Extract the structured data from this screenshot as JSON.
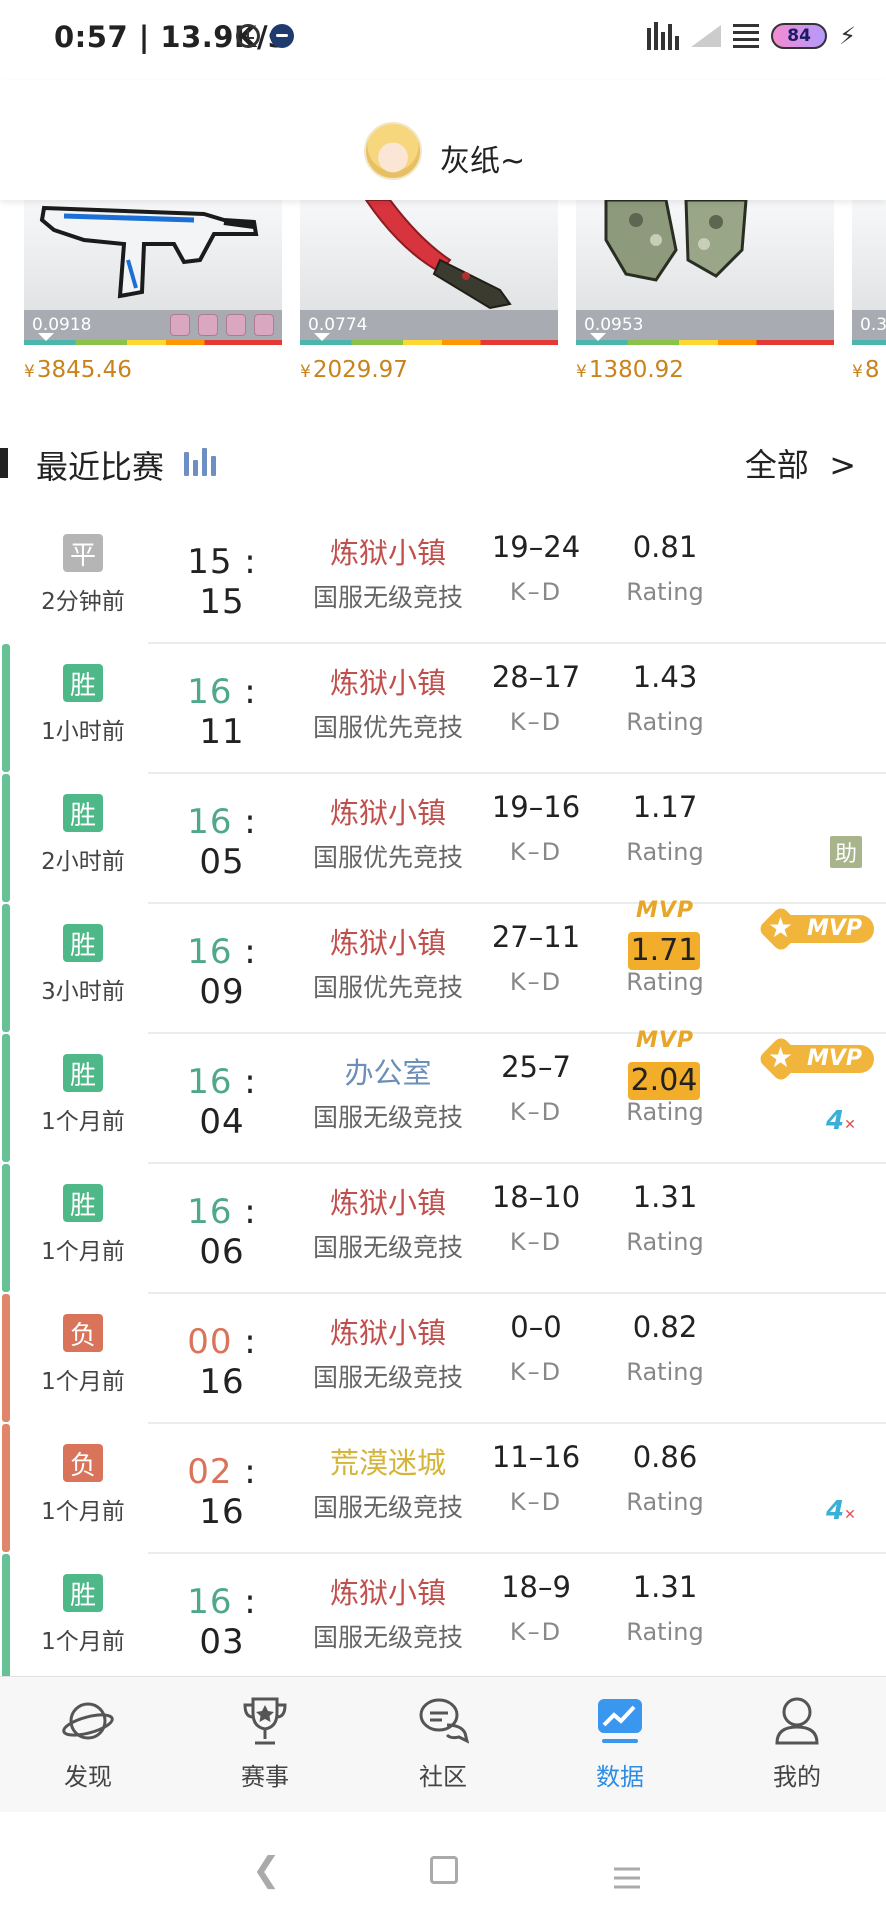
{
  "status_bar": {
    "time_speed": "0:57 | 13.9K/s",
    "battery": "84"
  },
  "header": {
    "username": "灰纸~"
  },
  "skins": [
    {
      "wear": "0.0918",
      "price": "3845.46",
      "currency": "¥"
    },
    {
      "wear": "0.0774",
      "price": "2029.97",
      "currency": "¥"
    },
    {
      "wear": "0.0953",
      "price": "1380.92",
      "currency": "¥"
    },
    {
      "wear": "0.3",
      "price": "8",
      "currency": "¥"
    }
  ],
  "section": {
    "title": "最近比赛",
    "all_label": "全部",
    "chevron": ">"
  },
  "common": {
    "kd_label": "K–D",
    "rating_label": "Rating",
    "mvp_label": "MVP",
    "assist_label": "助",
    "fourk_label": "4"
  },
  "matches": [
    {
      "result": "平",
      "result_color": "#b5b5b5",
      "stripe": "",
      "time": "2分钟前",
      "score_a": "15",
      "score_b": "15",
      "score_a_color": "#222222",
      "map": "炼狱小镇",
      "map_color": "#c0504d",
      "mode": "国服无级竞技",
      "kd": "19–24",
      "rating": "0.81",
      "mvp": false,
      "badge_mvp": false,
      "assist": false,
      "fourk": false
    },
    {
      "result": "胜",
      "result_color": "#4fb889",
      "stripe": "#66c295",
      "time": "1小时前",
      "score_a": "16",
      "score_b": "11",
      "score_a_color": "#4fa88b",
      "map": "炼狱小镇",
      "map_color": "#c0504d",
      "mode": "国服优先竞技",
      "kd": "28–17",
      "rating": "1.43",
      "mvp": false,
      "badge_mvp": false,
      "assist": false,
      "fourk": false
    },
    {
      "result": "胜",
      "result_color": "#4fb889",
      "stripe": "#66c295",
      "time": "2小时前",
      "score_a": "16",
      "score_b": "05",
      "score_a_color": "#4fa88b",
      "map": "炼狱小镇",
      "map_color": "#c0504d",
      "mode": "国服优先竞技",
      "kd": "19–16",
      "rating": "1.17",
      "mvp": false,
      "badge_mvp": false,
      "assist": true,
      "fourk": false
    },
    {
      "result": "胜",
      "result_color": "#4fb889",
      "stripe": "#66c295",
      "time": "3小时前",
      "score_a": "16",
      "score_b": "09",
      "score_a_color": "#4fa88b",
      "map": "炼狱小镇",
      "map_color": "#c0504d",
      "mode": "国服优先竞技",
      "kd": "27–11",
      "rating": "1.71",
      "mvp": true,
      "badge_mvp": true,
      "assist": false,
      "fourk": false
    },
    {
      "result": "胜",
      "result_color": "#4fb889",
      "stripe": "#66c295",
      "time": "1个月前",
      "score_a": "16",
      "score_b": "04",
      "score_a_color": "#4fa88b",
      "map": "办公室",
      "map_color": "#6c8fb8",
      "mode": "国服无级竞技",
      "kd": "25–7",
      "rating": "2.04",
      "mvp": true,
      "badge_mvp": true,
      "assist": false,
      "fourk": true
    },
    {
      "result": "胜",
      "result_color": "#4fb889",
      "stripe": "#66c295",
      "time": "1个月前",
      "score_a": "16",
      "score_b": "06",
      "score_a_color": "#4fa88b",
      "map": "炼狱小镇",
      "map_color": "#c0504d",
      "mode": "国服无级竞技",
      "kd": "18–10",
      "rating": "1.31",
      "mvp": false,
      "badge_mvp": false,
      "assist": false,
      "fourk": false
    },
    {
      "result": "负",
      "result_color": "#d9745a",
      "stripe": "#e0866b",
      "time": "1个月前",
      "score_a": "00",
      "score_b": "16",
      "score_a_color": "#d9745a",
      "map": "炼狱小镇",
      "map_color": "#c0504d",
      "mode": "国服无级竞技",
      "kd": "0–0",
      "rating": "0.82",
      "mvp": false,
      "badge_mvp": false,
      "assist": false,
      "fourk": false
    },
    {
      "result": "负",
      "result_color": "#d9745a",
      "stripe": "#e0866b",
      "time": "1个月前",
      "score_a": "02",
      "score_b": "16",
      "score_a_color": "#d9745a",
      "map": "荒漠迷城",
      "map_color": "#d4b43a",
      "mode": "国服无级竞技",
      "kd": "11–16",
      "rating": "0.86",
      "mvp": false,
      "badge_mvp": false,
      "assist": false,
      "fourk": true
    },
    {
      "result": "胜",
      "result_color": "#4fb889",
      "stripe": "#66c295",
      "time": "1个月前",
      "score_a": "16",
      "score_b": "03",
      "score_a_color": "#4fa88b",
      "map": "炼狱小镇",
      "map_color": "#c0504d",
      "mode": "国服无级竞技",
      "kd": "18–9",
      "rating": "1.31",
      "mvp": false,
      "badge_mvp": false,
      "assist": false,
      "fourk": false
    }
  ],
  "nav": {
    "items": [
      {
        "label": "发现",
        "icon": "planet-icon"
      },
      {
        "label": "赛事",
        "icon": "trophy-icon"
      },
      {
        "label": "社区",
        "icon": "chat-icon"
      },
      {
        "label": "数据",
        "icon": "chart-icon",
        "active": true
      },
      {
        "label": "我的",
        "icon": "person-icon"
      }
    ],
    "active_color": "#2f8de4"
  }
}
